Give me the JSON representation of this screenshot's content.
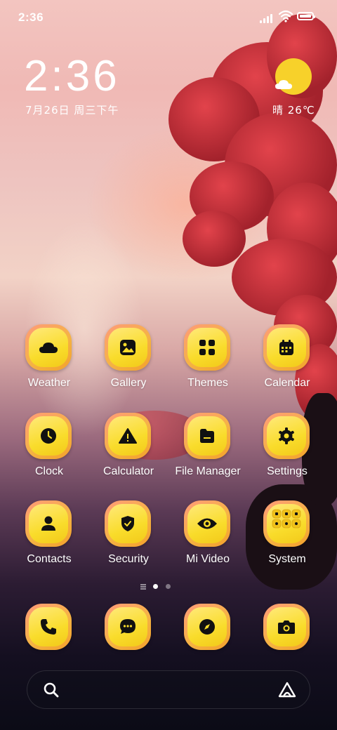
{
  "status_bar": {
    "time": "2:36"
  },
  "clock_widget": {
    "time": "2:36",
    "date": "7月26日 周三下午"
  },
  "weather_widget": {
    "text": "晴 26℃",
    "icon": "sunny-cloud-icon"
  },
  "apps": [
    {
      "label": "Weather",
      "icon": "cloud-icon"
    },
    {
      "label": "Gallery",
      "icon": "image-icon"
    },
    {
      "label": "Themes",
      "icon": "grid-icon"
    },
    {
      "label": "Calendar",
      "icon": "calendar-icon"
    },
    {
      "label": "Clock",
      "icon": "clock-icon"
    },
    {
      "label": "Calculator",
      "icon": "warning-icon"
    },
    {
      "label": "File Manager",
      "icon": "folder-icon"
    },
    {
      "label": "Settings",
      "icon": "gear-icon"
    },
    {
      "label": "Contacts",
      "icon": "person-icon"
    },
    {
      "label": "Security",
      "icon": "shield-check-icon"
    },
    {
      "label": "Mi Video",
      "icon": "eye-icon"
    },
    {
      "label": "System",
      "icon": "folder-grid-icon"
    }
  ],
  "dock": [
    {
      "name": "phone",
      "icon": "phone-icon"
    },
    {
      "name": "messages",
      "icon": "chat-icon"
    },
    {
      "name": "browser",
      "icon": "compass-icon"
    },
    {
      "name": "camera",
      "icon": "camera-icon"
    }
  ],
  "pager": {
    "pages": 2,
    "current": 1
  },
  "colors": {
    "icon_yellow": "#f9dc2b",
    "icon_glyph": "#111111",
    "tree_red": "#d93a44"
  }
}
